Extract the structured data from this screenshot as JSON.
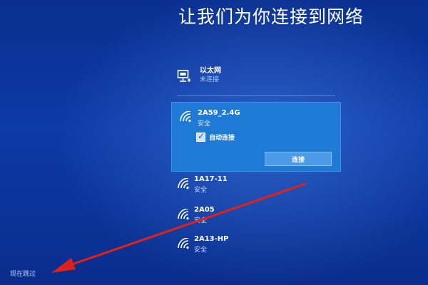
{
  "title": "让我们为你连接到网络",
  "ethernet": {
    "name": "以太网",
    "status": "未连接",
    "icon": "ethernet-icon"
  },
  "selected_network": {
    "name": "2A59_2.4G",
    "status": "安全",
    "icon": "wifi-icon",
    "auto_connect_label": "自动连接",
    "auto_connect_checked": true,
    "connect_label": "连接"
  },
  "networks": [
    {
      "name": "1A17-11",
      "status": "安全",
      "icon": "wifi-icon"
    },
    {
      "name": "2A05",
      "status": "安全",
      "icon": "wifi-icon"
    },
    {
      "name": "2A13-HP",
      "status": "安全",
      "icon": "wifi-icon"
    }
  ],
  "skip_label": "现在跳过",
  "colors": {
    "background": "#0c3aa6",
    "selected_item": "#1f7ad6",
    "button": "#4b9be8",
    "annotation_arrow": "#e0201a"
  }
}
